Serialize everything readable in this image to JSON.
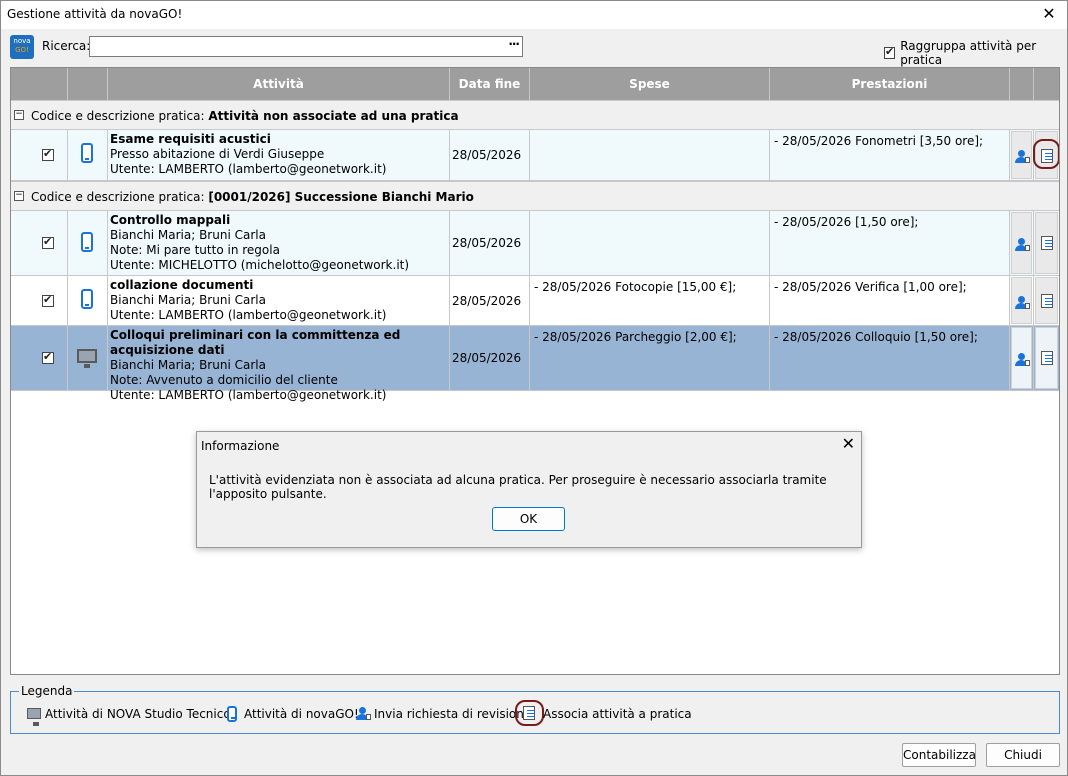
{
  "window": {
    "title": "Gestione attività da novaGO!",
    "close_glyph": "✕"
  },
  "logo": {
    "line1": "nova",
    "line2": "GO!"
  },
  "search": {
    "label": "Ricerca:",
    "value": "",
    "more_glyph": "···"
  },
  "group_option": {
    "label": "Raggruppa attività per pratica",
    "checked": true
  },
  "columns": {
    "activity": "Attività",
    "end_date": "Data fine",
    "expenses": "Spese",
    "services": "Prestazioni"
  },
  "groups": [
    {
      "prefix": "Codice e descrizione pratica:",
      "name": "Attività non associate ad una pratica"
    },
    {
      "prefix": "Codice e descrizione pratica:",
      "name": "[0001/2026] Successione Bianchi Mario"
    }
  ],
  "rows": [
    {
      "title": "Esame requisiti acustici",
      "line2": "Presso abitazione di Verdi Giuseppe",
      "line3": "Utente: LAMBERTO (lamberto@geonetwork.it)",
      "line4": "",
      "date": "28/05/2026",
      "expenses": "",
      "services": "- 28/05/2026 Fonometri [3,50 ore];",
      "source": "phone-icon"
    },
    {
      "title": "Controllo mappali",
      "line2": "Bianchi Maria; Bruni Carla",
      "line3": "Note: Mi pare tutto in regola",
      "line4": "Utente: MICHELOTTO (michelotto@geonetwork.it)",
      "date": "28/05/2026",
      "expenses": "",
      "services": "- 28/05/2026  [1,50 ore];",
      "source": "phone-icon"
    },
    {
      "title": "collazione documenti",
      "line2": "Bianchi Maria; Bruni Carla",
      "line3": "Utente: LAMBERTO (lamberto@geonetwork.it)",
      "line4": "",
      "date": "28/05/2026",
      "expenses": "- 28/05/2026 Fotocopie [15,00 €];",
      "services": "- 28/05/2026 Verifica [1,00 ore];",
      "source": "phone-icon"
    },
    {
      "title": "Colloqui preliminari con la committenza ed acquisizione dati",
      "line2": "Bianchi Maria; Bruni Carla",
      "line3": "Note: Avvenuto a domicilio del cliente",
      "line4": "Utente: LAMBERTO (lamberto@geonetwork.it)",
      "date": "28/05/2026",
      "expenses": "- 28/05/2026 Parcheggio  [2,00 €];",
      "services": "- 28/05/2026 Colloquio  [1,50 ore];",
      "source": "monitor-icon"
    }
  ],
  "dialog": {
    "title": "Informazione",
    "close_glyph": "✕",
    "message": "L'attività evidenziata non è associata ad alcuna pratica. Per proseguire è necessario associarla tramite l'apposito pulsante.",
    "ok_label": "OK"
  },
  "legend": {
    "title": "Legenda",
    "items": [
      {
        "icon": "monitor-icon",
        "label": "Attività di NOVA Studio Tecnico"
      },
      {
        "icon": "phone-icon",
        "label": "Attività di novaGO!"
      },
      {
        "icon": "send-revision-icon",
        "label": "Invia richiesta di revisione"
      },
      {
        "icon": "associate-icon",
        "label": "Associa attività a pratica"
      }
    ]
  },
  "buttons": {
    "post": "Contabilizza",
    "close": "Chiudi"
  },
  "colors": {
    "header": "#9e9e9e",
    "selected_row": "#98b4d4",
    "accent": "#1a73d8",
    "highlight_ring": "#7a1a1a"
  }
}
